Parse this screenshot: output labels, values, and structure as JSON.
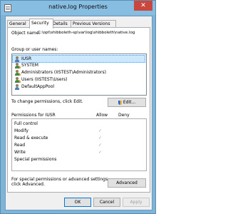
{
  "window": {
    "title": "native.log Properties",
    "close_glyph": "✕"
  },
  "tabs": [
    {
      "label": "General"
    },
    {
      "label": "Security"
    },
    {
      "label": "Details"
    },
    {
      "label": "Previous Versions"
    }
  ],
  "security": {
    "object_name_label": "Object name:",
    "object_name_value": "C:\\opt\\shibboleth-sp\\var\\log\\shibboleth\\native.log",
    "group_label": "Group or user names:",
    "users": [
      {
        "name": "IUSR",
        "icon": "user-icon",
        "selected": true
      },
      {
        "name": "SYSTEM",
        "icon": "group-icon"
      },
      {
        "name": "Administrators (IISTEST\\Administrators)",
        "icon": "group-icon"
      },
      {
        "name": "Users (IISTEST\\Users)",
        "icon": "group-icon"
      },
      {
        "name": "DefaultAppPool",
        "icon": "user-icon"
      }
    ],
    "change_text": "To change permissions, click Edit.",
    "edit_label": "Edit...",
    "permissions_header": "Permissions for IUSR",
    "allow_header": "Allow",
    "deny_header": "Deny",
    "permissions": [
      {
        "name": "Full control",
        "allow": "",
        "deny": ""
      },
      {
        "name": "Modify",
        "allow": "✓",
        "deny": ""
      },
      {
        "name": "Read & execute",
        "allow": "✓",
        "deny": ""
      },
      {
        "name": "Read",
        "allow": "✓",
        "deny": ""
      },
      {
        "name": "Write",
        "allow": "✓",
        "deny": ""
      },
      {
        "name": "Special permissions",
        "allow": "",
        "deny": ""
      }
    ],
    "advanced_text_1": "For special permissions or advanced settings,",
    "advanced_text_2": "click Advanced.",
    "advanced_label": "Advanced"
  },
  "footer": {
    "ok_label": "OK",
    "cancel_label": "Cancel",
    "apply_label": "Apply"
  }
}
